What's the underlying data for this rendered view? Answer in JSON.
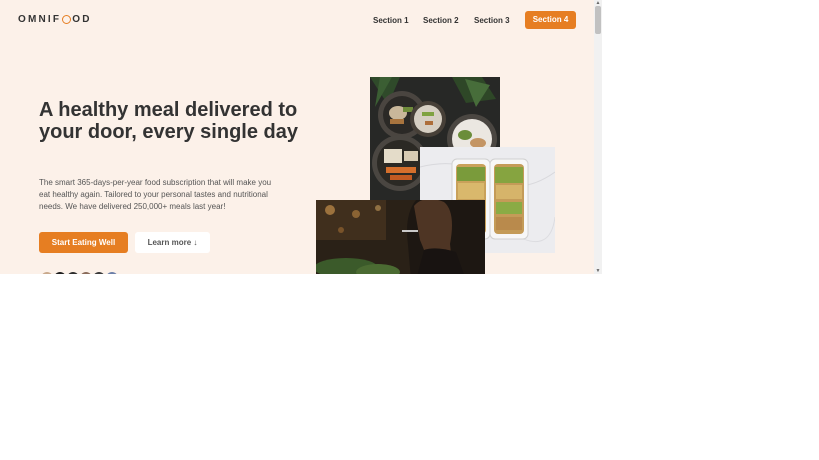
{
  "brand": {
    "logo_prefix": "OMNIF",
    "logo_suffix": "OD",
    "accent": "#e67e22"
  },
  "nav": {
    "items": [
      {
        "label": "Section 1"
      },
      {
        "label": "Section 2"
      },
      {
        "label": "Section 3"
      }
    ],
    "cta_label": "Section 4"
  },
  "hero": {
    "title": "A healthy meal delivered to your door, every single day",
    "description": "The smart 365-days-per-year food subscription that will make you eat healthy again. Tailored to your personal tastes and nutritional needs. We have delivered 250,000+ meals last year!",
    "primary_button": "Start Eating Well",
    "secondary_button": "Learn more ↓"
  },
  "images": [
    {
      "name": "food-bowls-photo"
    },
    {
      "name": "meal-prep-containers-photo"
    },
    {
      "name": "woman-eating-photo"
    }
  ],
  "avatars": [
    {
      "color": "#c9a98c"
    },
    {
      "color": "#1e1e1e"
    },
    {
      "color": "#2d2d2d"
    },
    {
      "color": "#8a6b5a"
    },
    {
      "color": "#3a3a3a"
    },
    {
      "color": "#6c7fa8"
    }
  ]
}
